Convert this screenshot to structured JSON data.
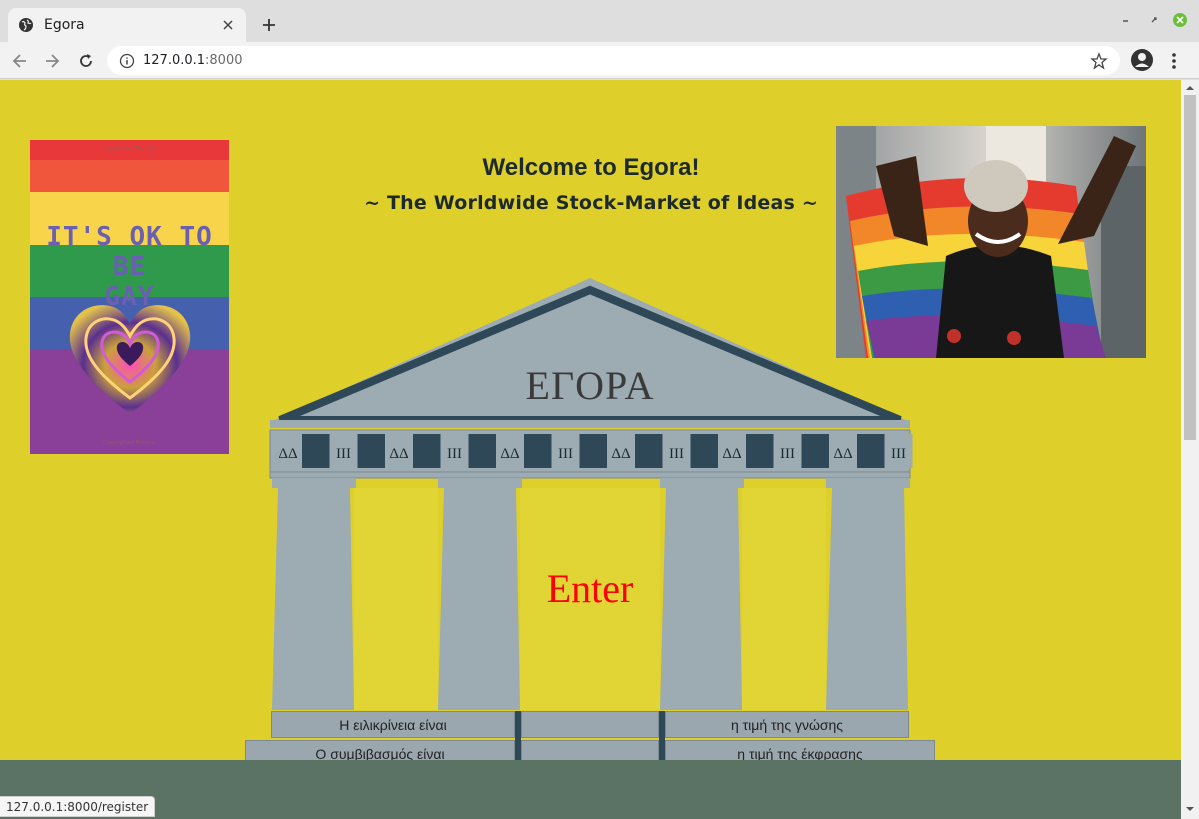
{
  "browser": {
    "tab_title": "Egora",
    "url_host": "127.0.0.1",
    "url_port": ":8000",
    "status_url": "127.0.0.1:8000/register"
  },
  "page": {
    "headline": "Welcome to Egora!",
    "subline": "~ The Worldwide Stock-Market of Ideas ~",
    "temple_title": "ΕΓΟΡΑ",
    "enter_label": "Enter",
    "frieze_pattern": [
      "ΔΔ",
      "III",
      "ΔΔ",
      "III",
      "ΔΔ",
      "III",
      "ΔΔ",
      "III",
      "ΔΔ",
      "III",
      "ΔΔ",
      "III"
    ],
    "steps": {
      "left_top": "Η ειλικρίνεια είναι",
      "left_bottom": "Ο συμβιβασμός είναι",
      "right_top": "η τιμή της γνώσης",
      "right_bottom": "η τιμή της έκφρασης"
    },
    "poster": {
      "slogan_line1": "IT'S OK TO BE",
      "slogan_line2": "GAY",
      "copyright_top": "Copyrighted Material",
      "copyright_bottom": "Copyrighted Material"
    },
    "photo_alt": ""
  },
  "colors": {
    "page_background": "#dfcf2b",
    "ground": "#5a7364",
    "temple_stone": "#9dabb3",
    "temple_dark": "#2f4858",
    "enter_text": "#ff0000"
  },
  "icons": {
    "favicon": "globe-icon",
    "tab_close": "close-icon",
    "new_tab": "plus-icon",
    "back": "back-arrow-icon",
    "forward": "forward-arrow-icon",
    "reload": "reload-icon",
    "site_info": "info-icon",
    "bookmark": "star-icon",
    "profile": "account-icon",
    "menu": "kebab-menu-icon"
  }
}
